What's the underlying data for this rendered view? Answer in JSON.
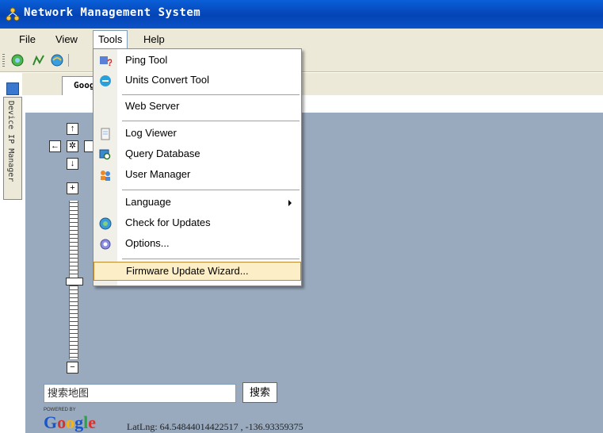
{
  "window": {
    "title": "Network Management System"
  },
  "menubar": {
    "items": [
      {
        "label": "File"
      },
      {
        "label": "View"
      },
      {
        "label": "Tools"
      },
      {
        "label": "Help"
      }
    ]
  },
  "sidebar": {
    "tab_label": "Device IP Manager"
  },
  "tab": {
    "label": "Google"
  },
  "map_controls": {
    "pan_up": "↑",
    "pan_left": "←",
    "pan_center": "✲",
    "pan_down": "↓",
    "zoom_in": "+",
    "zoom_out": "−"
  },
  "search": {
    "placeholder": "搜索地图",
    "button_label": "搜索"
  },
  "footer": {
    "powered_by": "POWERED BY",
    "google": "Google",
    "latlng": "LatLng: 64.54844014422517 , -136.93359375"
  },
  "tools_menu": {
    "ping": "Ping Tool",
    "units": "Units Convert Tool",
    "web": "Web Server",
    "log": "Log Viewer",
    "query": "Query Database",
    "user": "User Manager",
    "language": "Language",
    "updates": "Check for Updates",
    "options": "Options...",
    "firmware": "Firmware Update Wizard..."
  },
  "colors": {
    "accent": "#0a5fd8",
    "map_bg": "#99aabe",
    "menu_highlight": "#fcefc7"
  }
}
